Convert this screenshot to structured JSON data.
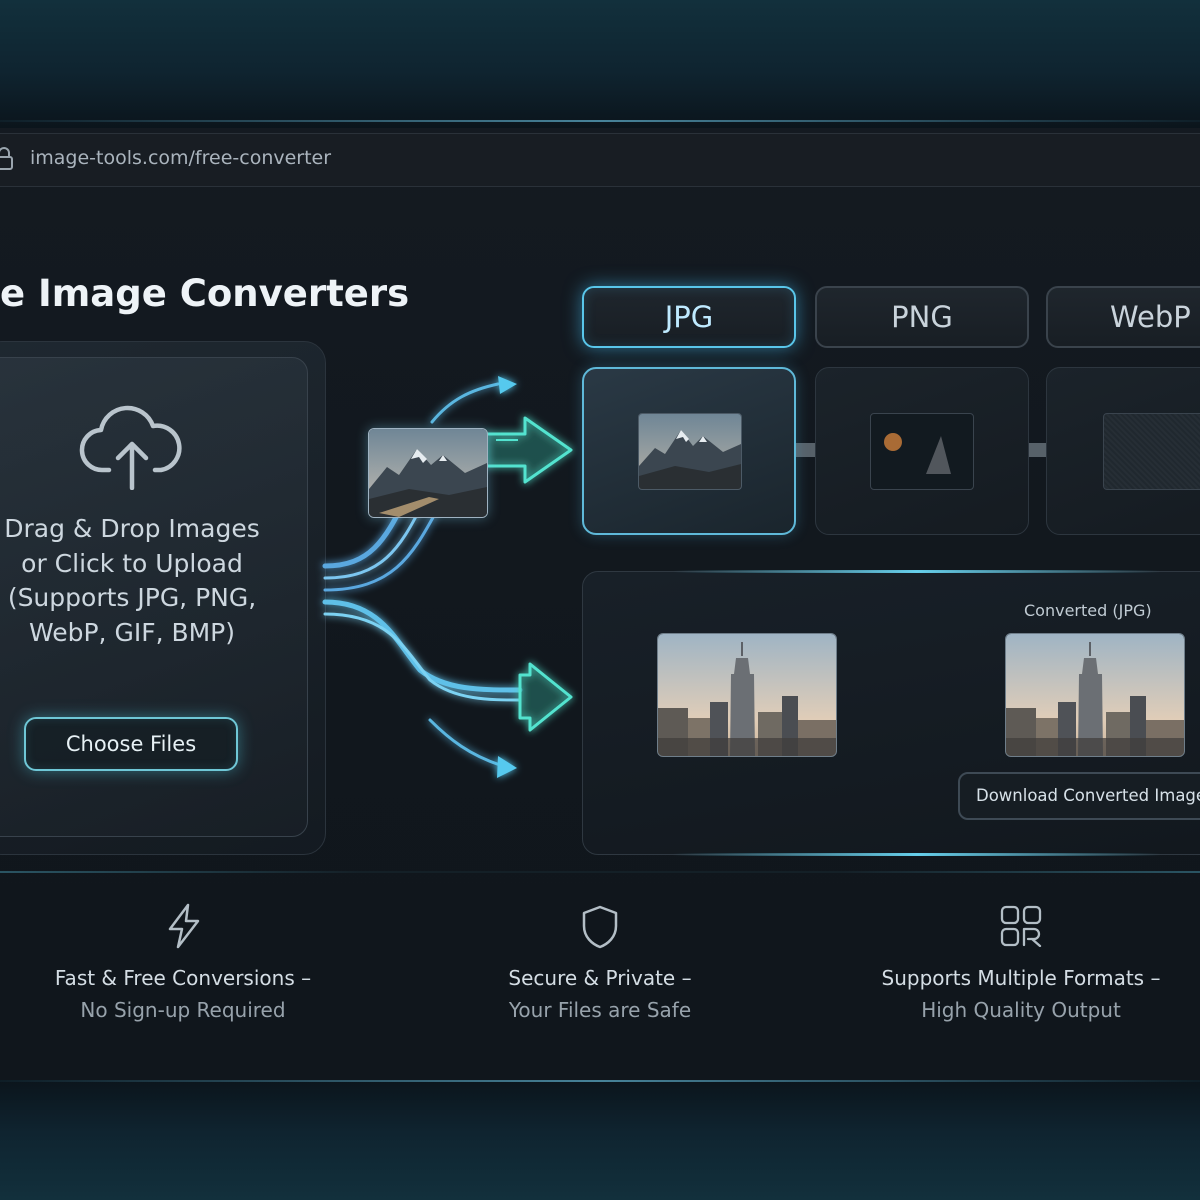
{
  "browser": {
    "url": "image-tools.com/free-converter"
  },
  "page": {
    "title": "e Image Converters"
  },
  "upload": {
    "prompt": "Drag & Drop Images or Click to Upload (Supports JPG, PNG, WebP, GIF, BMP)",
    "button_label": "Choose Files"
  },
  "formats": {
    "tabs": [
      {
        "label": "JPG",
        "active": true
      },
      {
        "label": "PNG",
        "active": false
      },
      {
        "label": "WebP",
        "active": false
      }
    ]
  },
  "conversion": {
    "result_label": "Converted (JPG)",
    "download_label": "Download Converted Image"
  },
  "features": [
    {
      "icon": "lightning-icon",
      "line1": "Fast & Free Conversions –",
      "line2": "No Sign-up Required"
    },
    {
      "icon": "shield-icon",
      "line1": "Secure & Private –",
      "line2": "Your Files are Safe"
    },
    {
      "icon": "formats-grid-icon",
      "line1": "Supports Multiple Formats –",
      "line2": "High Quality Output"
    }
  ],
  "colors": {
    "accent": "#59c6ea",
    "accent_teal": "#4fe0d0",
    "background": "#11171d"
  }
}
